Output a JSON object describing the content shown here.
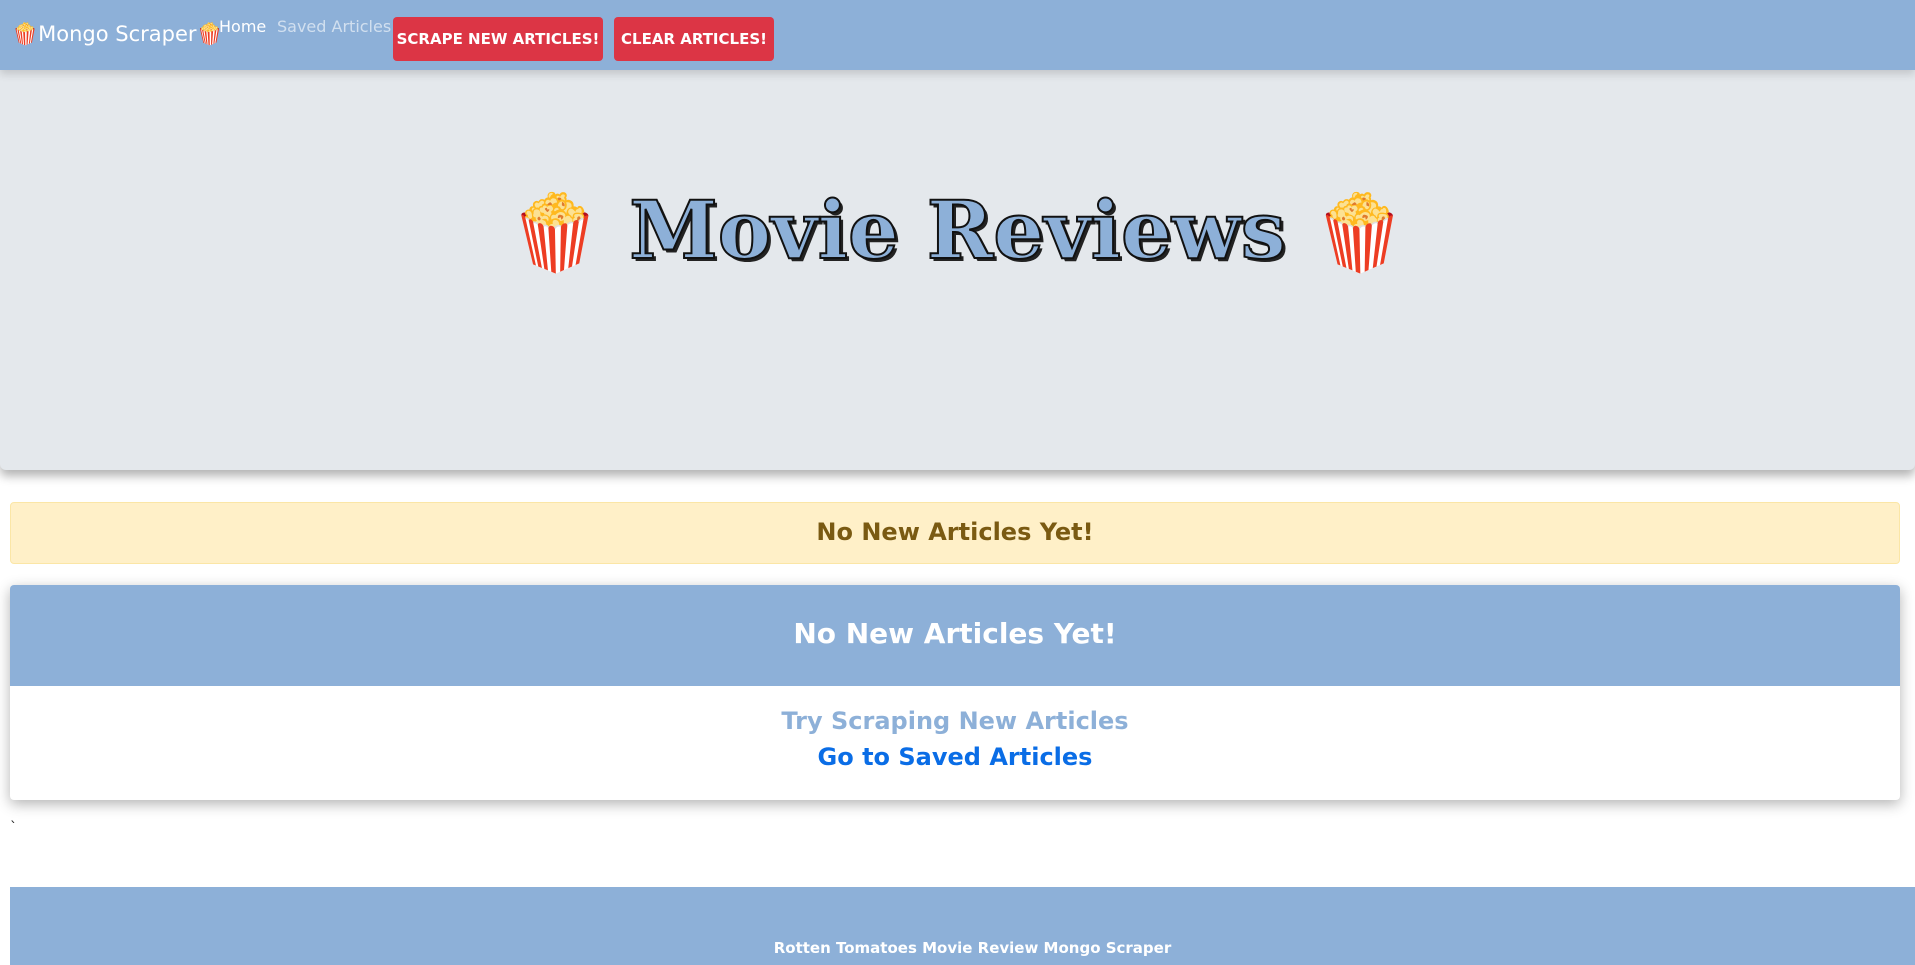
{
  "navbar": {
    "brand_left_icon": "🍿",
    "brand_text": "Mongo Scraper",
    "brand_right_icon": "🍿",
    "links": [
      {
        "label": "Home",
        "active": true
      },
      {
        "label": "Saved Articles",
        "active": false
      }
    ],
    "buttons": {
      "scrape_label": "SCRAPE NEW ARTICLES!",
      "clear_label": "CLEAR ARTICLES!"
    }
  },
  "hero": {
    "left_icon": "🍿",
    "title": "Movie Reviews",
    "right_icon": "🍿"
  },
  "alert": {
    "text": "No New Articles Yet!"
  },
  "card": {
    "header": "No New Articles Yet!",
    "try_link": "Try Scraping New Articles",
    "saved_link": "Go to Saved Articles"
  },
  "stray_text": "`",
  "footer": {
    "text": "Rotten Tomatoes Movie Review Mongo Scraper"
  },
  "colors": {
    "navbar": "#8db0d8",
    "danger": "#dc3545",
    "jumbotron": "#e4e8ec",
    "alert_bg": "#fff0c8",
    "link_blue": "#0a6de6"
  }
}
